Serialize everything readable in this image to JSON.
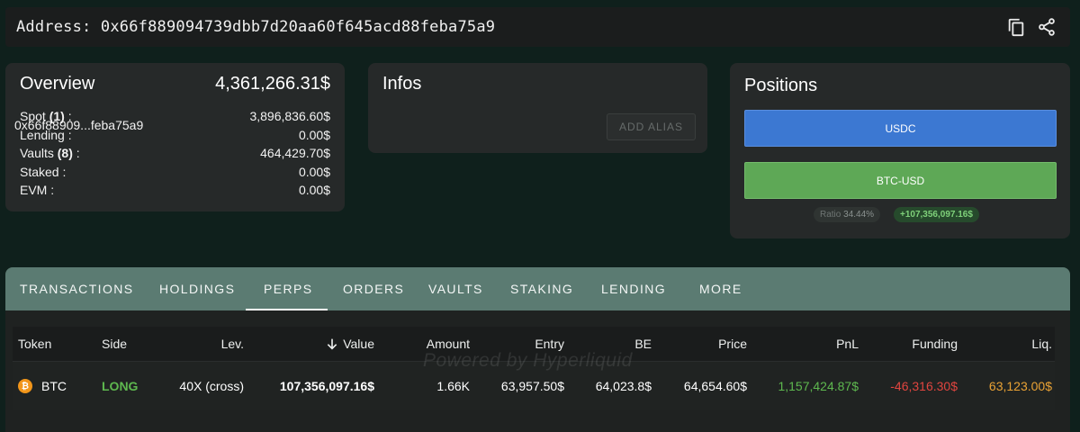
{
  "address_bar": {
    "label": "Address:",
    "address": "0x66f889094739dbb7d20aa60f645acd88feba75a9",
    "icons": [
      "copy-icon",
      "share-icon"
    ]
  },
  "overview": {
    "title": "Overview",
    "total": "4,361,266.31$",
    "rows": [
      {
        "label": "Spot",
        "count": "(1)",
        "suffix": " :",
        "value": "3,896,836.60$"
      },
      {
        "label": "Lending :",
        "count": "",
        "suffix": "",
        "value": "0.00$"
      },
      {
        "label": "Vaults",
        "count": "(8)",
        "suffix": " :",
        "value": "464,429.70$"
      },
      {
        "label": "Staked :",
        "count": "",
        "suffix": "",
        "value": "0.00$"
      },
      {
        "label": "EVM :",
        "count": "",
        "suffix": "",
        "value": "0.00$"
      }
    ]
  },
  "infos": {
    "title": "Infos",
    "short_address": "0x66f88909...feba75a9",
    "alias_button": "ADD ALIAS"
  },
  "positions": {
    "title": "Positions",
    "bars": [
      {
        "label": "USDC",
        "color": "#3c78d2"
      },
      {
        "label": "BTC-USD",
        "color": "#5ea856"
      }
    ],
    "ratio_label": "Ratio",
    "ratio_value": "34.44%",
    "pnl": "+107,356,097.16$"
  },
  "tabs": {
    "items": [
      "TRANSACTIONS",
      "HOLDINGS",
      "PERPS",
      "ORDERS",
      "VAULTS",
      "STAKING",
      "LENDING",
      "MORE"
    ],
    "active": "PERPS"
  },
  "table": {
    "headers": {
      "token": "Token",
      "side": "Side",
      "lev": "Lev.",
      "value": "Value",
      "amount": "Amount",
      "entry": "Entry",
      "be": "BE",
      "price": "Price",
      "pnl": "PnL",
      "funding": "Funding",
      "liq": "Liq."
    },
    "sort_icon": "arrow-down-icon",
    "rows": [
      {
        "token": "BTC",
        "side": "LONG",
        "lev": "40X (cross)",
        "value": "107,356,097.16$",
        "amount": "1.66K",
        "entry": "63,957.50$",
        "be": "64,023.8$",
        "price": "64,654.60$",
        "pnl": "1,157,424.87$",
        "funding": "-46,316.30$",
        "liq": "63,123.00$"
      }
    ]
  },
  "watermark": "Powered by Hyperliquid"
}
